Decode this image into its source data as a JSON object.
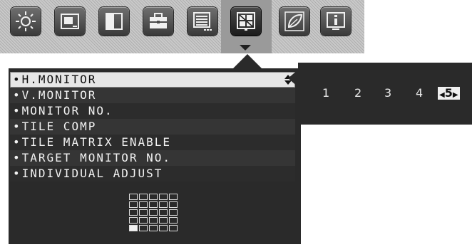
{
  "toolbar": {
    "tabs": [
      {
        "name": "brightness-icon"
      },
      {
        "name": "picture-in-window-icon"
      },
      {
        "name": "color-contrast-icon"
      },
      {
        "name": "toolbox-icon"
      },
      {
        "name": "osd-menu-icon"
      },
      {
        "name": "tile-matrix-icon",
        "active": true
      },
      {
        "name": "eco-leaf-icon"
      },
      {
        "name": "information-icon"
      }
    ]
  },
  "menu": {
    "items": [
      {
        "label": "H.MONITOR"
      },
      {
        "label": "V.MONITOR"
      },
      {
        "label": "MONITOR NO."
      },
      {
        "label": "TILE COMP"
      },
      {
        "label": "TILE MATRIX ENABLE"
      },
      {
        "label": "TARGET MONITOR NO."
      },
      {
        "label": "INDIVIDUAL ADJUST"
      }
    ],
    "selected_index": 0,
    "bullet": "•"
  },
  "submenu": {
    "options": [
      "1",
      "2",
      "3",
      "4",
      "5"
    ],
    "selected": "5"
  },
  "tile_matrix": {
    "columns": 5,
    "rows": 5,
    "highlighted": {
      "row": 5,
      "column": 1
    }
  }
}
